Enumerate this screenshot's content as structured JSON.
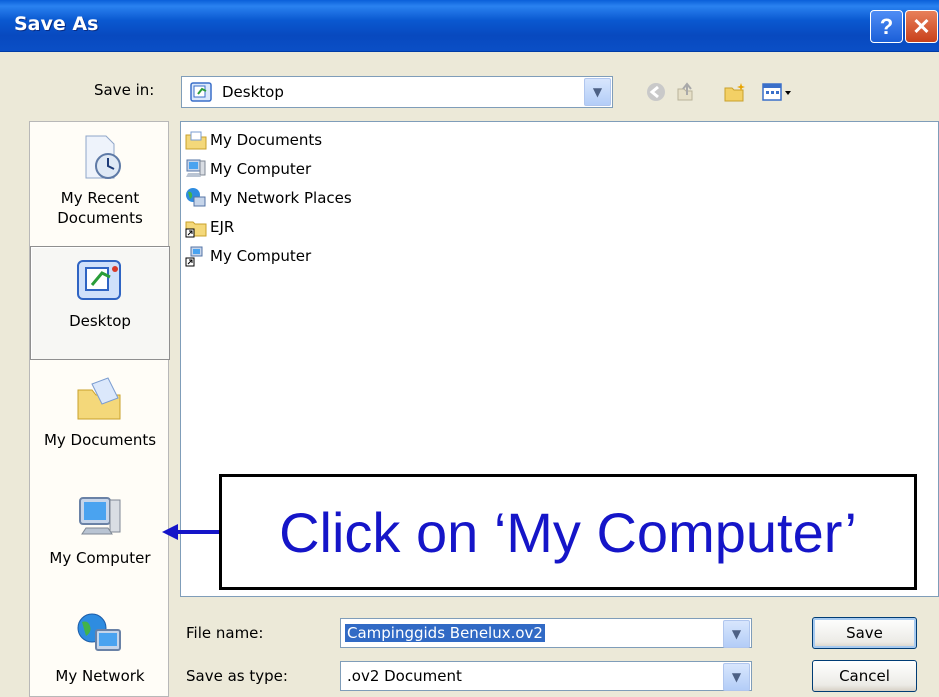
{
  "window": {
    "title": "Save As",
    "help_glyph": "?",
    "close_glyph": "✕"
  },
  "save_in": {
    "label": "Save in:",
    "value": "Desktop",
    "icon": "desktop-icon"
  },
  "toolbar": {
    "icons": [
      "back-icon",
      "up-folder-icon",
      "new-folder-icon",
      "views-menu-icon"
    ]
  },
  "places": [
    {
      "label_line1": "My Recent",
      "label_line2": "Documents",
      "icon": "recent-documents-icon"
    },
    {
      "label_line1": "Desktop",
      "label_line2": "",
      "icon": "desktop-icon",
      "selected": true
    },
    {
      "label_line1": "My Documents",
      "label_line2": "",
      "icon": "my-documents-icon"
    },
    {
      "label_line1": "My Computer",
      "label_line2": "",
      "icon": "my-computer-icon"
    },
    {
      "label_line1": "My Network",
      "label_line2": "",
      "icon": "my-network-icon"
    }
  ],
  "files": [
    {
      "name": "My Documents",
      "icon": "folder-docs-icon"
    },
    {
      "name": "My Computer",
      "icon": "computer-icon"
    },
    {
      "name": "My Network Places",
      "icon": "network-places-icon"
    },
    {
      "name": "EJR",
      "icon": "folder-shortcut-icon"
    },
    {
      "name": "My Computer",
      "icon": "computer-shortcut-icon"
    }
  ],
  "file_name": {
    "label": "File name:",
    "value": "Campinggids Benelux.ov2"
  },
  "save_as_type": {
    "label": "Save as type:",
    "value": ".ov2 Document"
  },
  "buttons": {
    "save": "Save",
    "cancel": "Cancel"
  },
  "annotation": {
    "text": "Click on ‘My Computer’",
    "color": "#1515c8"
  },
  "colors": {
    "titlebar": "#0a58d0",
    "selection": "#316ac5"
  }
}
